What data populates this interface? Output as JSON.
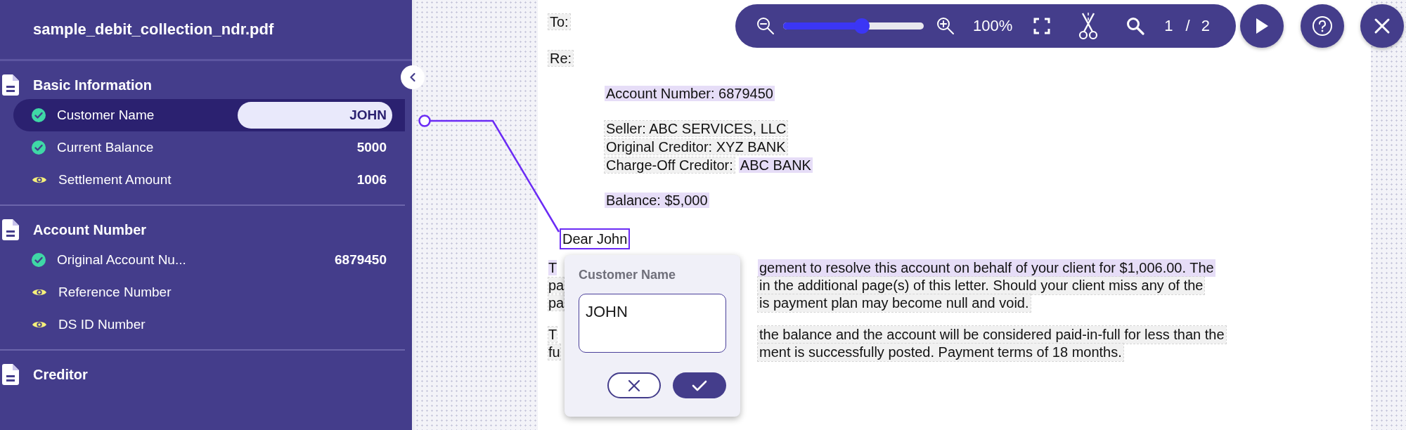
{
  "sidebar": {
    "filename": "sample_debit_collection_ndr.pdf",
    "sections": [
      {
        "title": "Basic Information",
        "fields": [
          {
            "label": "Customer Name",
            "value": "JOHN",
            "kind": "verified",
            "selected": true
          },
          {
            "label": "Current Balance",
            "value": "5000",
            "kind": "verified",
            "selected": false
          },
          {
            "label": "Settlement Amount",
            "value": "1006",
            "kind": "review",
            "selected": false
          }
        ]
      },
      {
        "title": "Account Number",
        "fields": [
          {
            "label": "Original Account Nu...",
            "value": "6879450",
            "kind": "verified",
            "selected": false
          },
          {
            "label": "Reference Number",
            "kind": "review",
            "selected": false
          },
          {
            "label": "DS ID Number",
            "kind": "review",
            "selected": false
          }
        ]
      },
      {
        "title": "Creditor"
      }
    ]
  },
  "toolbar": {
    "zoom_slider": {
      "level": 0.56
    },
    "zoom": "100%",
    "page_current": "1",
    "page_separator": "/",
    "page_total": "2"
  },
  "document": {
    "labels": [
      {
        "text": "To:",
        "highlighted": false
      },
      {
        "text": "Re:",
        "highlighted": false
      }
    ],
    "details": [
      [
        [
          {
            "text": "Account Number: 6879450",
            "highlighted": true
          }
        ]
      ],
      [
        [
          {
            "text": "Seller: ABC SERVICES, LLC",
            "highlighted": false
          }
        ],
        [
          {
            "text": "Original Creditor: XYZ BANK",
            "highlighted": false
          }
        ],
        [
          {
            "text": "Charge-Off Creditor:",
            "highlighted": false
          },
          {
            "text": "ABC BANK",
            "highlighted": true
          }
        ]
      ],
      [
        [
          {
            "text": "Balance: $5,000",
            "highlighted": true
          }
        ]
      ]
    ],
    "greeting": "Dear John",
    "paragraphs": [
      [
        {
          "left": "T",
          "right": "gement to resolve this account on behalf of your client for $1,006.00. The",
          "highlighted": true
        },
        {
          "left": "pa",
          "right": "in the additional page(s) of this letter. Should your client miss any of the",
          "highlighted": false
        },
        {
          "left": "pa",
          "right": "is payment plan may become null and void.",
          "highlighted": false
        }
      ],
      [
        {
          "left": "T",
          "right": "the balance and the account will be considered paid-in-full for less than the",
          "highlighted": false
        },
        {
          "left": "fu",
          "right": "ment is successfully posted. Payment terms of 18 months.",
          "highlighted": false
        }
      ]
    ]
  },
  "popup": {
    "title": "Customer Name",
    "value": "JOHN"
  }
}
